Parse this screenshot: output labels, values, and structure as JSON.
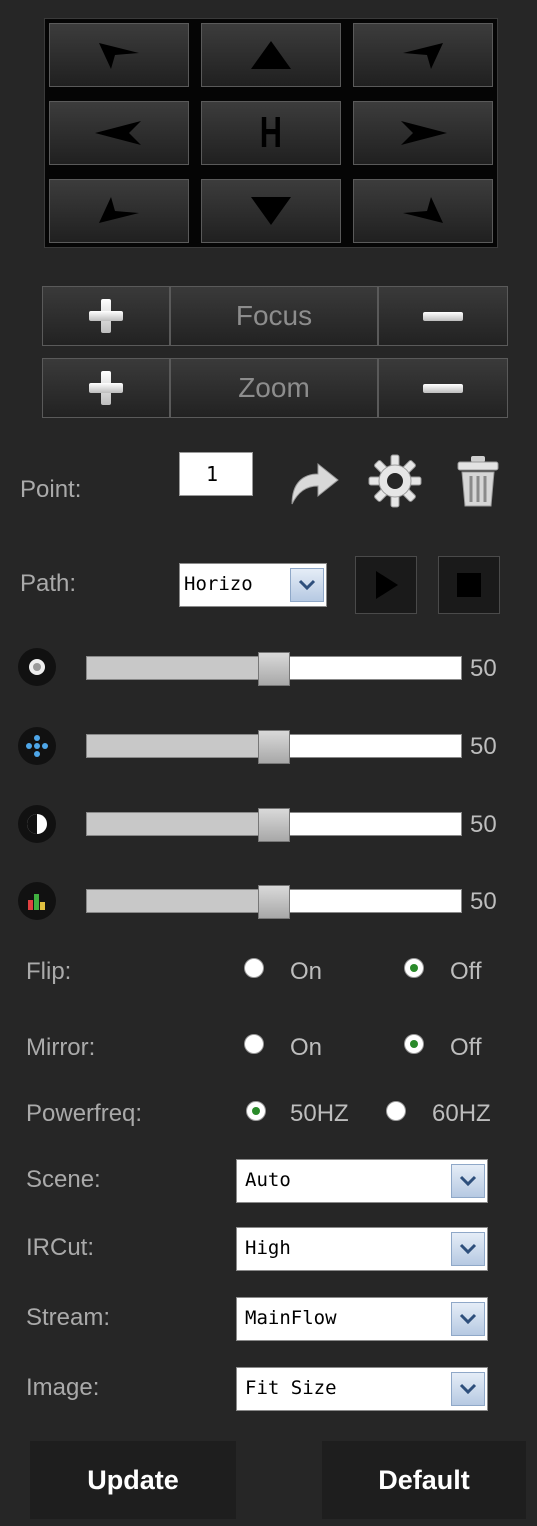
{
  "ptz": {
    "home_label": "H",
    "directions": [
      "up-left",
      "up",
      "up-right",
      "left",
      "home",
      "right",
      "down-left",
      "down",
      "down-right"
    ]
  },
  "focus": {
    "label": "Focus"
  },
  "zoom": {
    "label": "Zoom"
  },
  "point": {
    "label": "Point:",
    "value": "1"
  },
  "path": {
    "label": "Path:",
    "selected": "Horizo"
  },
  "sliders": [
    {
      "icon": "brightness-icon",
      "value": "50",
      "level": 50
    },
    {
      "icon": "saturation-icon",
      "value": "50",
      "level": 50
    },
    {
      "icon": "contrast-icon",
      "value": "50",
      "level": 50
    },
    {
      "icon": "chroma-icon",
      "value": "50",
      "level": 50
    }
  ],
  "flip": {
    "label": "Flip:",
    "on_label": "On",
    "off_label": "Off",
    "selected": "Off"
  },
  "mirror": {
    "label": "Mirror:",
    "on_label": "On",
    "off_label": "Off",
    "selected": "Off"
  },
  "powerfreq": {
    "label": "Powerfreq:",
    "opt1_label": "50HZ",
    "opt2_label": "60HZ",
    "selected": "50HZ"
  },
  "scene": {
    "label": "Scene:",
    "selected": "Auto"
  },
  "ircut": {
    "label": "IRCut:",
    "selected": "High"
  },
  "stream": {
    "label": "Stream:",
    "selected": "MainFlow"
  },
  "image": {
    "label": "Image:",
    "selected": "Fit Size"
  },
  "buttons": {
    "update": "Update",
    "default": "Default"
  },
  "colors": {
    "background": "#262626",
    "radio_selected": "#2a8a2a",
    "dropdown_arrow": "#b6c9e2"
  }
}
